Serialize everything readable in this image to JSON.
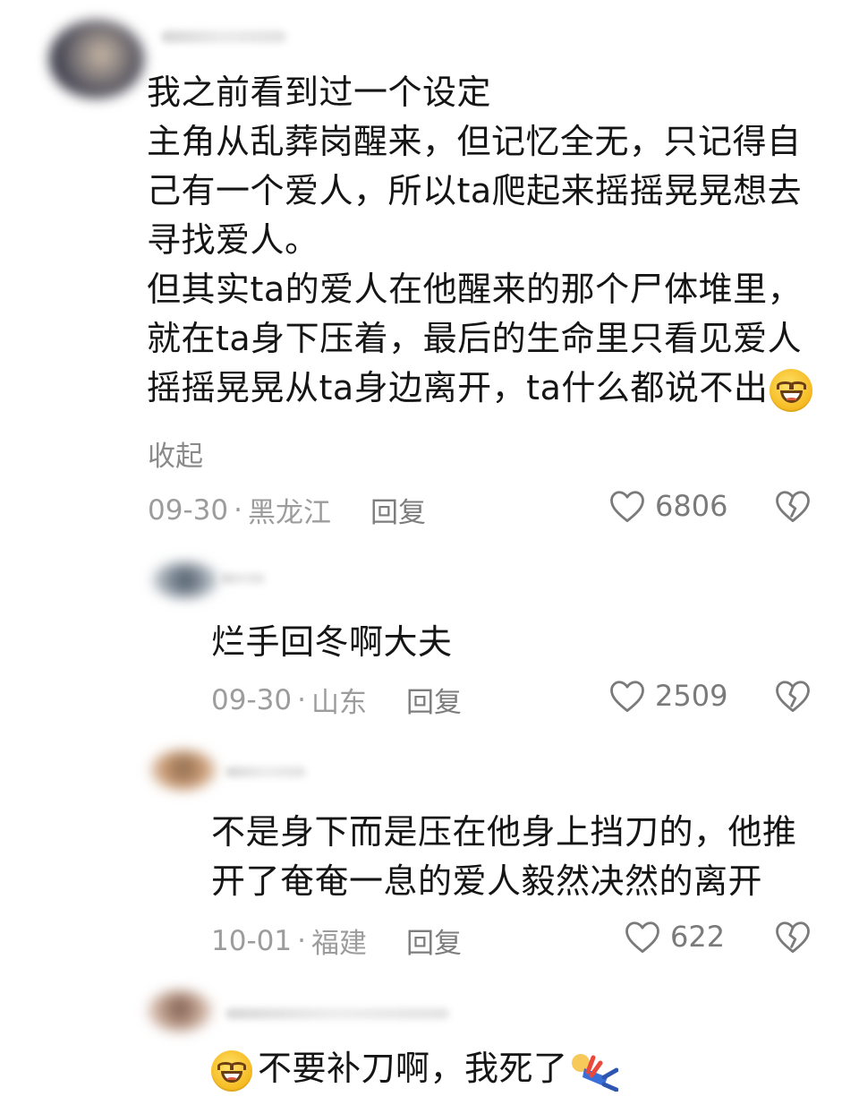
{
  "comments": [
    {
      "lines": [
        "我之前看到过一个设定",
        "主角从乱葬岗醒来，但记忆全无，只记得自",
        "己有一个爱人，所以ta爬起来摇摇晃晃想去",
        "寻找爱人。",
        "但其实ta的爱人在他醒来的那个尸体堆里，",
        "就在ta身下压着，最后的生命里只看见爱人",
        "摇摇晃晃从ta身边离开，ta什么都说不出"
      ],
      "collapse_label": "收起",
      "date": "09-30",
      "location": "黑龙江",
      "reply_label": "回复",
      "likes": "6806"
    },
    {
      "lines": [
        "烂手回冬啊大夫"
      ],
      "date": "09-30",
      "location": "山东",
      "reply_label": "回复",
      "likes": "2509"
    },
    {
      "lines": [
        "不是身下而是压在他身上挡刀的，他推",
        "开了奄奄一息的爱人毅然决然的离开"
      ],
      "date": "10-01",
      "location": "福建",
      "reply_label": "回复",
      "likes": "622"
    },
    {
      "lines": [
        "不要补刀啊，我死了"
      ]
    }
  ],
  "icons": {
    "like": "heart-outline-icon",
    "dislike": "broken-heart-icon",
    "emoji_laugh": "grinning-sweat-emoji",
    "emoji_fall": "fallen-person-emoji"
  },
  "colors": {
    "text": "#151515",
    "meta": "#9c9c9c",
    "icon": "#7a7a7a"
  }
}
